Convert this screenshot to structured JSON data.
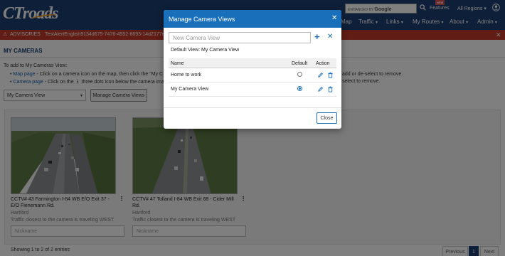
{
  "header": {
    "logo": "CTroads",
    "search_enhanced": "ENHANCED BY",
    "search_google": "Google",
    "features_label": "Features",
    "features_badge": "NEW",
    "regions_label": "All Regions",
    "nav": [
      {
        "label": "Map"
      },
      {
        "label": "Traffic"
      },
      {
        "label": "Links"
      },
      {
        "label": "My Routes"
      },
      {
        "label": "About"
      },
      {
        "label": "Admin"
      }
    ]
  },
  "advisory": {
    "label": "ADVISORIES",
    "message": "TestAlertEnglish9134d675-7476-4552-8693-14d2177e9"
  },
  "page": {
    "title": "MY CAMERAS",
    "intro": "To add to My Cameras View:",
    "map_link": "Map page",
    "map_text": " - Click on a camera icon on the map, then click the \"My C",
    "camera_link": "Camera page",
    "camera_text": " - Click on the",
    "camera_text2": " three dots icon below the camera imag",
    "map_text_right": "add or de-select to remove.",
    "camera_text_right": "select to remove.",
    "view_select": "My Camera View",
    "manage_button": "Manage Camera Views",
    "cameras": [
      {
        "title": "CCTV# 43 Farmington I-84 WB E/O Exit 37 - E/O Fienemann Rd.",
        "city": "Hartford",
        "direction": "Traffic closest to the camera is traveling WEST",
        "nickname_placeholder": "Nickname"
      },
      {
        "title": "CCTV# 47 Tolland I-84 WB Exit 68 - Cider Mill Rd.",
        "city": "Hartford",
        "direction": "Traffic closest to the camera is traveling WEST",
        "nickname_placeholder": "Nickname"
      }
    ],
    "showing": "Showing 1 to 2 of 2 entries",
    "pagination": {
      "previous": "Previous",
      "current": "1",
      "next": "Next"
    }
  },
  "modal": {
    "title": "Manage Camera Views",
    "new_view_placeholder": "New Camera View",
    "default_view_text": "Default View: My Camera View",
    "columns": {
      "name": "Name",
      "default": "Default",
      "action": "Action"
    },
    "rows": [
      {
        "name": "Home to work",
        "is_default": false
      },
      {
        "name": "My Camera View",
        "is_default": true
      }
    ],
    "close_button": "Close"
  },
  "colors": {
    "header_bg": "#1c3f73",
    "advisory_bg": "#c0392b",
    "modal_accent": "#1a6fba"
  }
}
